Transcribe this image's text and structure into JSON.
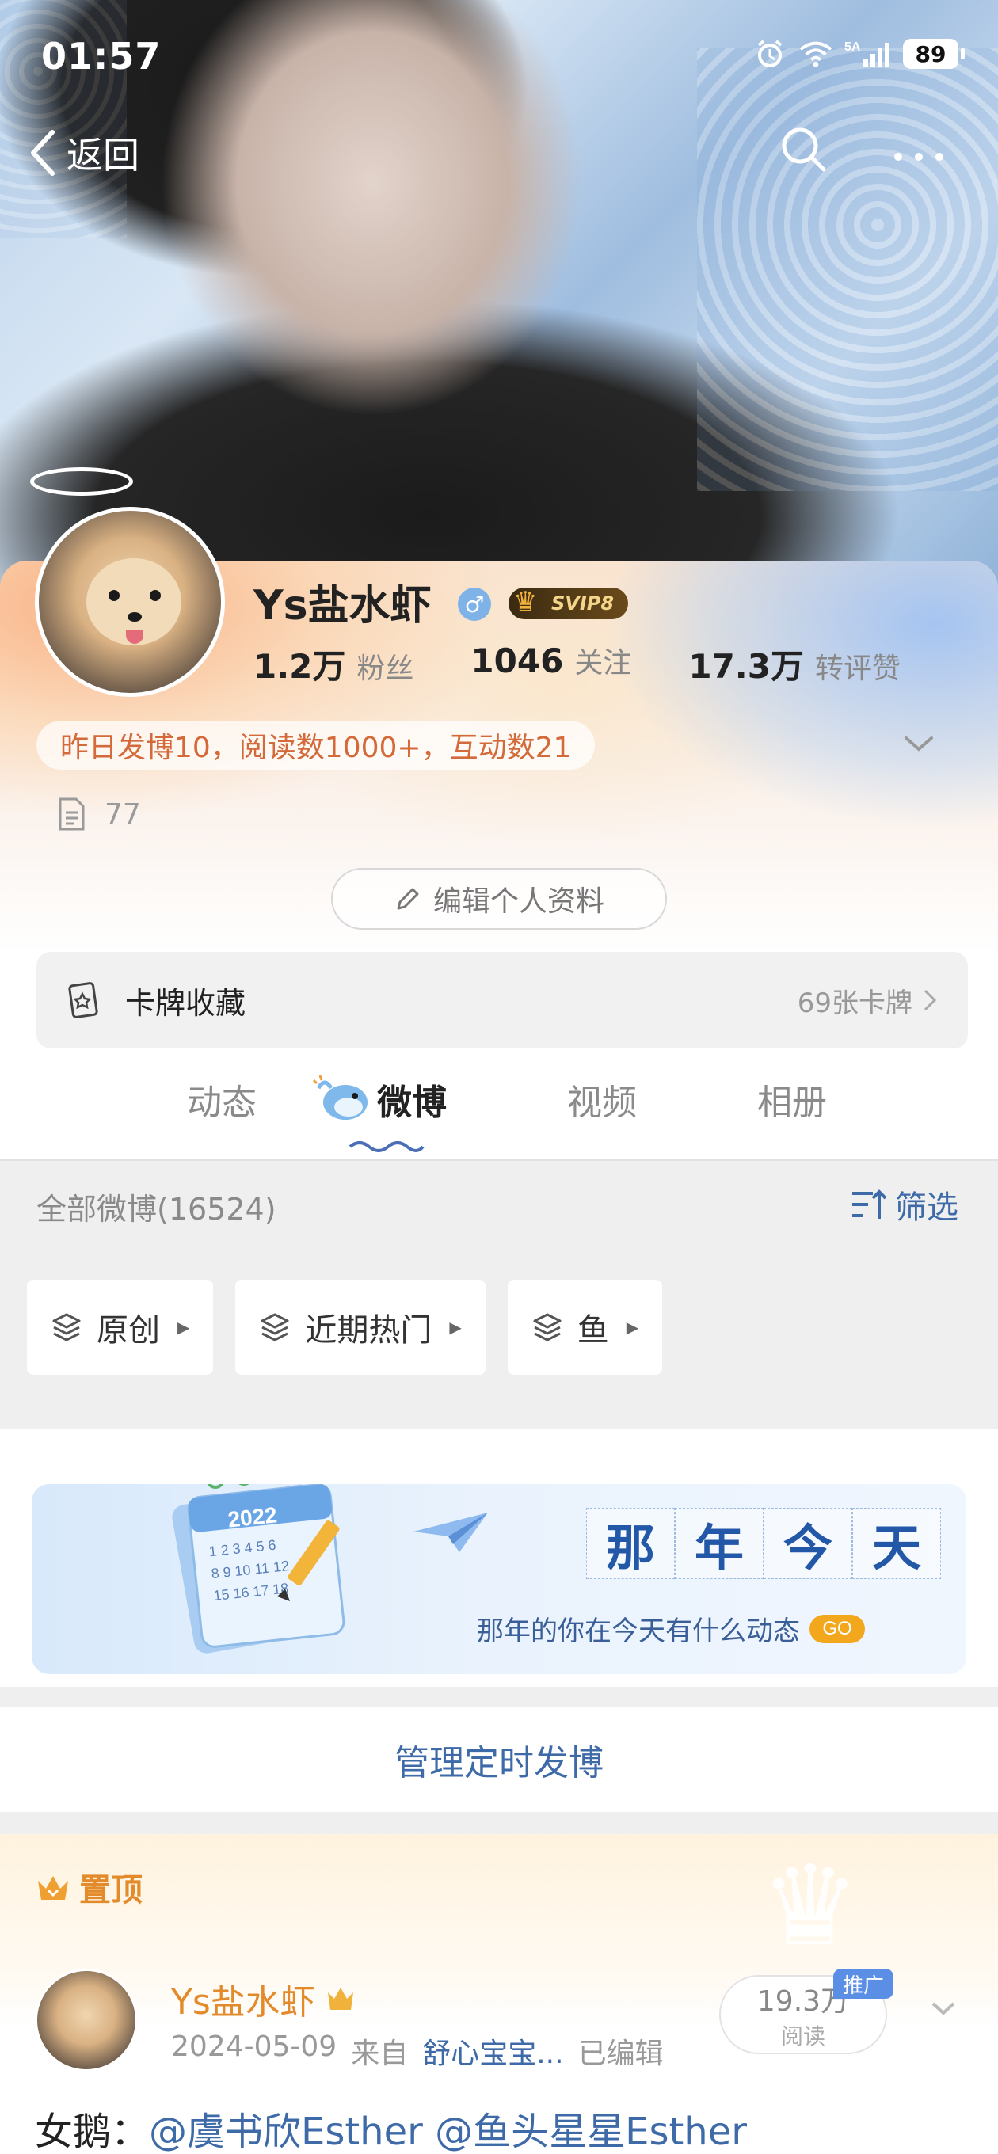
{
  "status_bar": {
    "time": "01:57",
    "battery": "89",
    "network": "5A"
  },
  "nav": {
    "back_label": "返回"
  },
  "profile": {
    "username": "Ys盐水虾",
    "gender_symbol": "♂",
    "vip_label": "SVIP8",
    "stats": [
      {
        "num": "1.2万",
        "label": "粉丝"
      },
      {
        "num": "1046",
        "label": "关注"
      },
      {
        "num": "17.3万",
        "label": "转评赞"
      }
    ],
    "daily_summary": "昨日发博10，阅读数1000+，互动数21",
    "doc_count": "77",
    "edit_label": "编辑个人资料",
    "card_collection": {
      "label": "卡牌收藏",
      "count": "69张卡牌"
    }
  },
  "tabs": [
    {
      "label": "动态",
      "active": false
    },
    {
      "label": "微博",
      "active": true
    },
    {
      "label": "视频",
      "active": false
    },
    {
      "label": "相册",
      "active": false
    }
  ],
  "filter": {
    "all_count": "全部微博(16524)",
    "filter_label": "筛选",
    "chips": [
      "原创",
      "近期热门",
      "鱼"
    ]
  },
  "banner": {
    "title_chars": [
      "那",
      "年",
      "今",
      "天"
    ],
    "subtitle": "那年的你在今天有什么动态",
    "go_label": "GO",
    "calendar_year": "2022"
  },
  "scheduled": {
    "label": "管理定时发博"
  },
  "pinned_post": {
    "pin_label": "置顶",
    "author": "Ys盐水虾",
    "date": "2024-05-09",
    "from_prefix": "来自",
    "source": "舒心宝宝...",
    "edited": "已编辑",
    "reads_num": "19.3万",
    "reads_label": "阅读",
    "promo_label": "推广",
    "text_prefix": "女鹅：",
    "mentions": [
      "@虞书欣Esther",
      "@鱼头星星Esther"
    ]
  },
  "colors": {
    "link_blue": "#3e6aa8",
    "orange": "#e38b2a",
    "daily_tag_text": "#d4693a",
    "go_badge": "#f2a71c"
  }
}
